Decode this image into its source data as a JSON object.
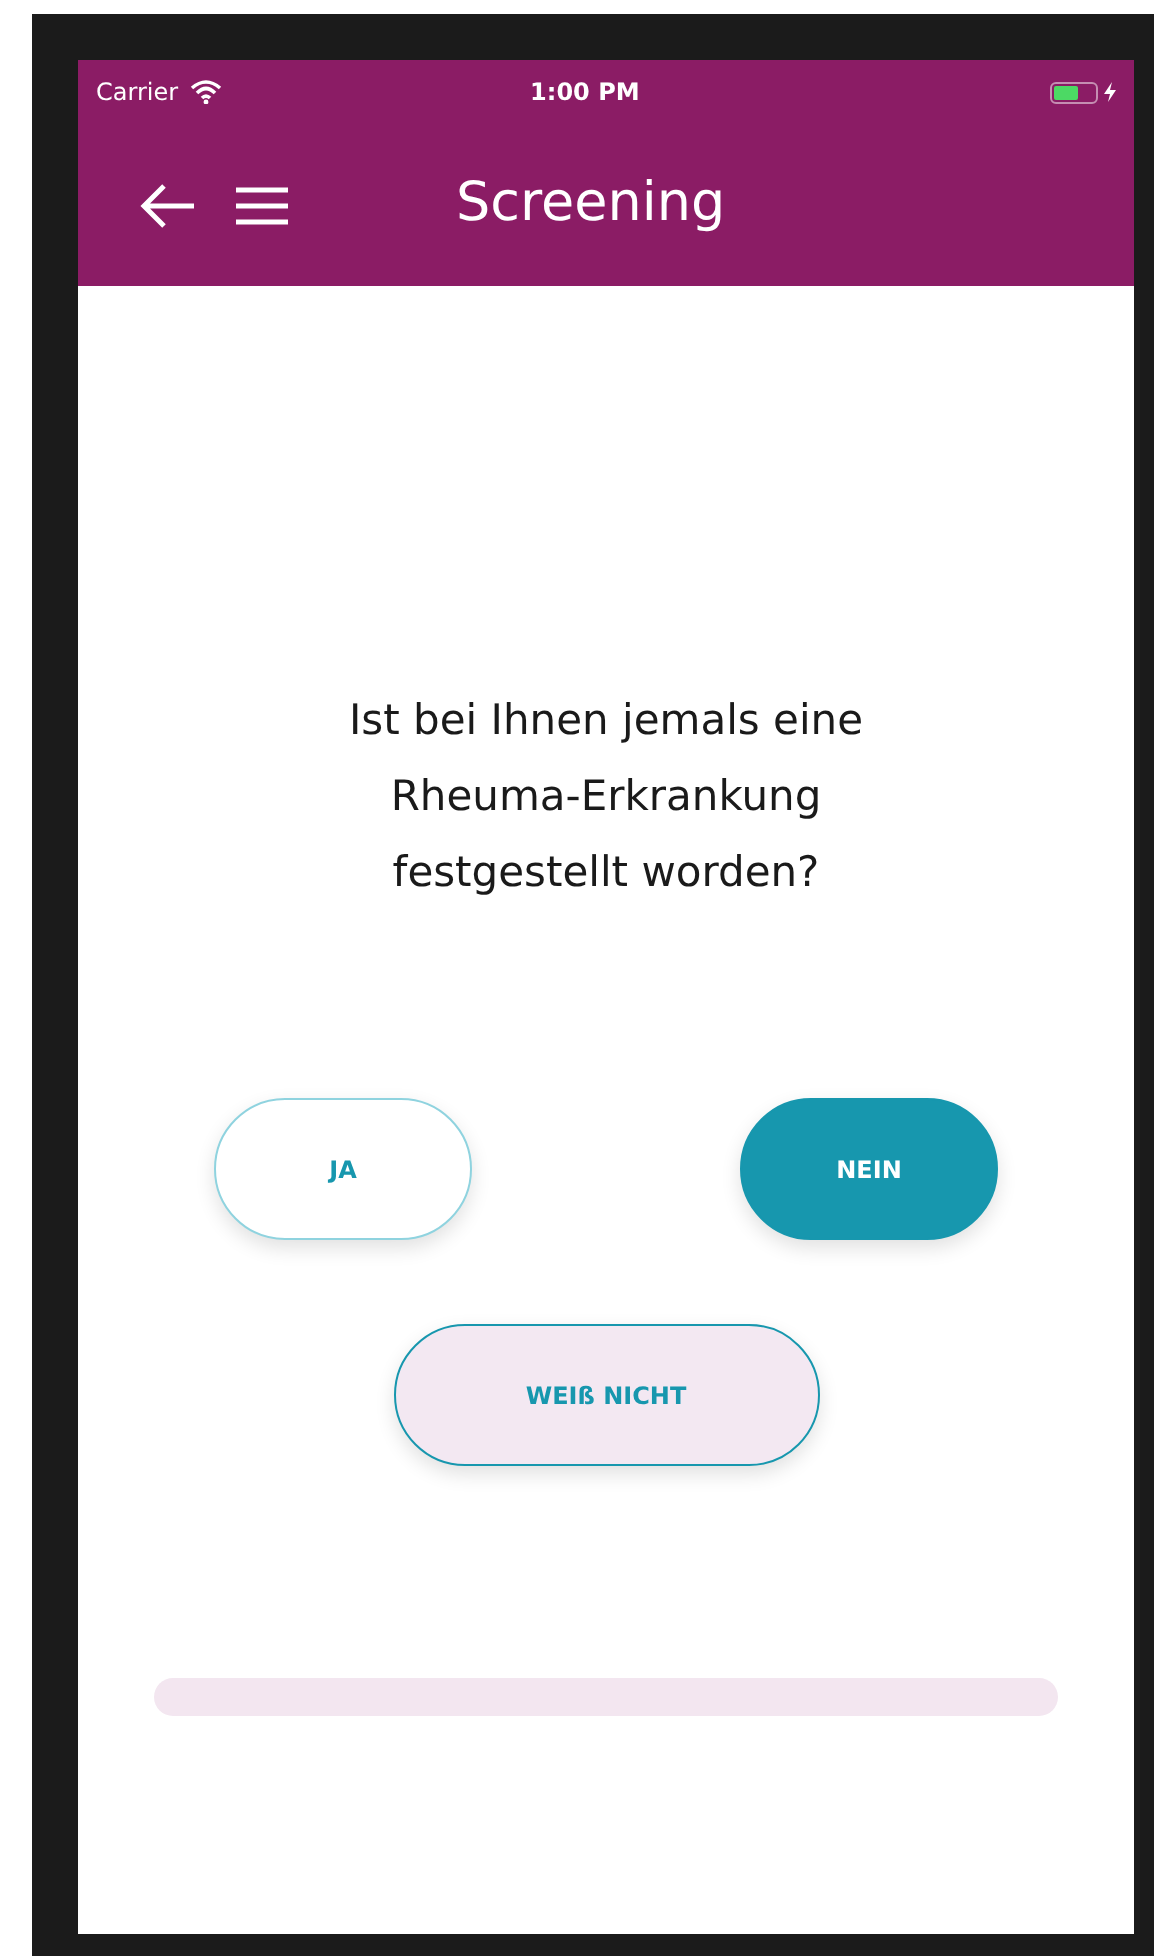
{
  "status_bar": {
    "carrier": "Carrier",
    "time": "1:00 PM",
    "charging": true
  },
  "header": {
    "title": "Screening"
  },
  "question": "Ist bei Ihnen jemals eine Rheuma-Erkrankung festgestellt worden?",
  "answers": [
    {
      "label": "JA",
      "selected": false,
      "highlighted": false
    },
    {
      "label": "NEIN",
      "selected": true,
      "highlighted": false
    },
    {
      "label": "WEIß NICHT",
      "selected": false,
      "highlighted": true
    }
  ],
  "progress": {
    "level": 0
  }
}
